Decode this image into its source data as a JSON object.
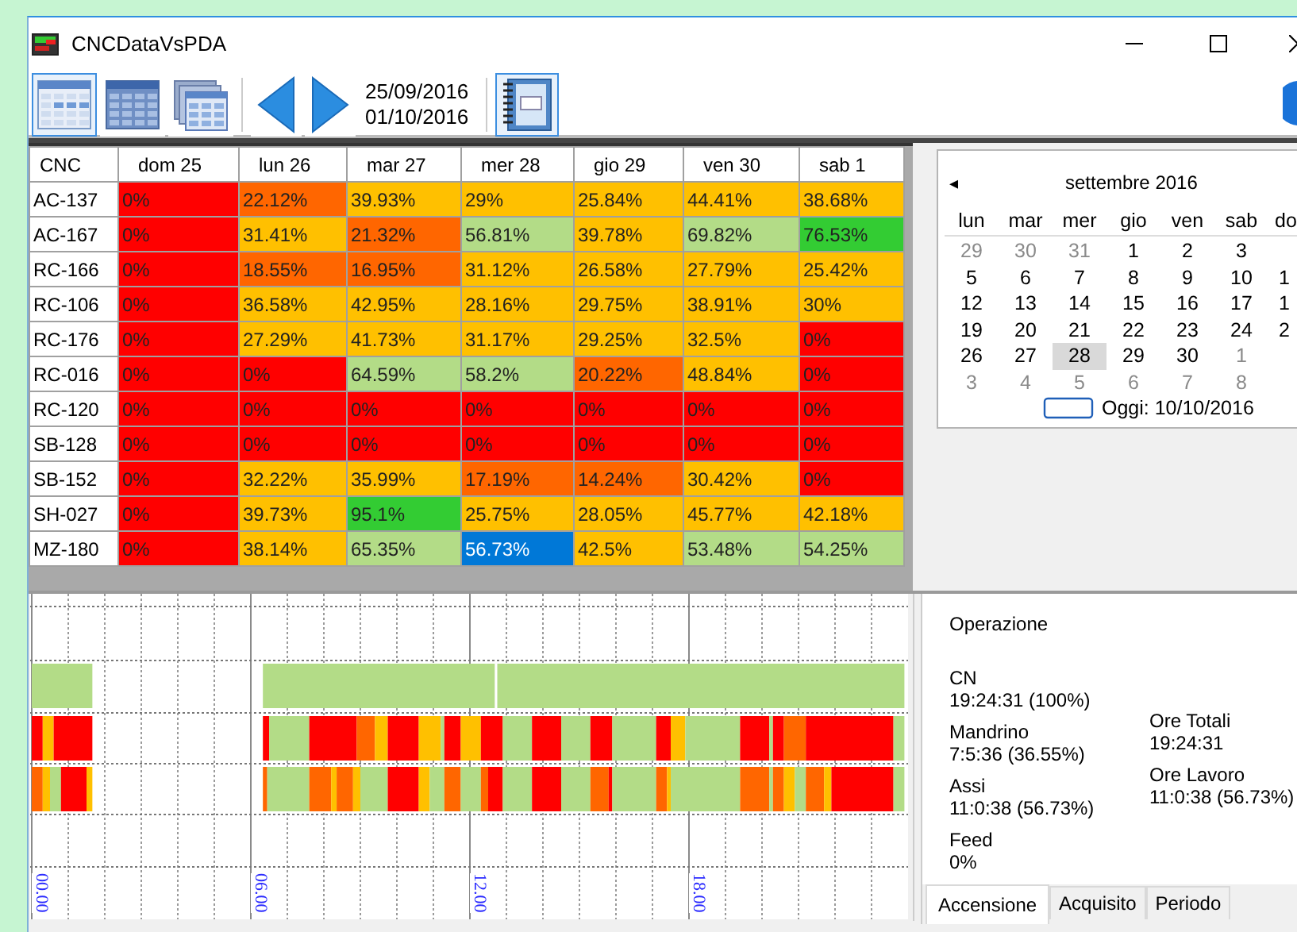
{
  "window": {
    "title": "CNCDataVsPDA"
  },
  "toolbar": {
    "view_buttons": [
      {
        "kind": "light",
        "selected": true
      },
      {
        "kind": "dark",
        "selected": false
      },
      {
        "kind": "stacked",
        "selected": false
      }
    ],
    "date_from": "25/09/2016",
    "date_to": "01/10/2016",
    "report_button": {
      "selected": true
    }
  },
  "table": {
    "columns": [
      "CNC",
      "dom 25",
      "lun 26",
      "mar 27",
      "mer 28",
      "gio 29",
      "ven 30",
      "sab 1"
    ],
    "rows": [
      {
        "cells": [
          {
            "kind": "name",
            "text": "AC-137"
          },
          {
            "kind": "value",
            "text": "0%",
            "color": "#ff0000",
            "selected": false
          },
          {
            "kind": "value",
            "text": "22.12%",
            "color": "#ff6600",
            "selected": false
          },
          {
            "kind": "value",
            "text": "39.93%",
            "color": "#ffc000",
            "selected": false
          },
          {
            "kind": "value",
            "text": "29%",
            "color": "#ffc000",
            "selected": false
          },
          {
            "kind": "value",
            "text": "25.84%",
            "color": "#ffc000",
            "selected": false
          },
          {
            "kind": "value",
            "text": "44.41%",
            "color": "#ffc000",
            "selected": false
          },
          {
            "kind": "value",
            "text": "38.68%",
            "color": "#ffc000",
            "selected": false
          }
        ]
      },
      {
        "cells": [
          {
            "kind": "name",
            "text": "AC-167"
          },
          {
            "kind": "value",
            "text": "0%",
            "color": "#ff0000",
            "selected": false
          },
          {
            "kind": "value",
            "text": "31.41%",
            "color": "#ffc000",
            "selected": false
          },
          {
            "kind": "value",
            "text": "21.32%",
            "color": "#ff6600",
            "selected": false
          },
          {
            "kind": "value",
            "text": "56.81%",
            "color": "#b3dc87",
            "selected": false
          },
          {
            "kind": "value",
            "text": "39.78%",
            "color": "#ffc000",
            "selected": false
          },
          {
            "kind": "value",
            "text": "69.82%",
            "color": "#b3dc87",
            "selected": false
          },
          {
            "kind": "value",
            "text": "76.53%",
            "color": "#33cc33",
            "selected": false
          }
        ]
      },
      {
        "cells": [
          {
            "kind": "name",
            "text": "RC-166"
          },
          {
            "kind": "value",
            "text": "0%",
            "color": "#ff0000",
            "selected": false
          },
          {
            "kind": "value",
            "text": "18.55%",
            "color": "#ff6600",
            "selected": false
          },
          {
            "kind": "value",
            "text": "16.95%",
            "color": "#ff6600",
            "selected": false
          },
          {
            "kind": "value",
            "text": "31.12%",
            "color": "#ffc000",
            "selected": false
          },
          {
            "kind": "value",
            "text": "26.58%",
            "color": "#ffc000",
            "selected": false
          },
          {
            "kind": "value",
            "text": "27.79%",
            "color": "#ffc000",
            "selected": false
          },
          {
            "kind": "value",
            "text": "25.42%",
            "color": "#ffc000",
            "selected": false
          }
        ]
      },
      {
        "cells": [
          {
            "kind": "name",
            "text": "RC-106"
          },
          {
            "kind": "value",
            "text": "0%",
            "color": "#ff0000",
            "selected": false
          },
          {
            "kind": "value",
            "text": "36.58%",
            "color": "#ffc000",
            "selected": false
          },
          {
            "kind": "value",
            "text": "42.95%",
            "color": "#ffc000",
            "selected": false
          },
          {
            "kind": "value",
            "text": "28.16%",
            "color": "#ffc000",
            "selected": false
          },
          {
            "kind": "value",
            "text": "29.75%",
            "color": "#ffc000",
            "selected": false
          },
          {
            "kind": "value",
            "text": "38.91%",
            "color": "#ffc000",
            "selected": false
          },
          {
            "kind": "value",
            "text": "30%",
            "color": "#ffc000",
            "selected": false
          }
        ]
      },
      {
        "cells": [
          {
            "kind": "name",
            "text": "RC-176"
          },
          {
            "kind": "value",
            "text": "0%",
            "color": "#ff0000",
            "selected": false
          },
          {
            "kind": "value",
            "text": "27.29%",
            "color": "#ffc000",
            "selected": false
          },
          {
            "kind": "value",
            "text": "41.73%",
            "color": "#ffc000",
            "selected": false
          },
          {
            "kind": "value",
            "text": "31.17%",
            "color": "#ffc000",
            "selected": false
          },
          {
            "kind": "value",
            "text": "29.25%",
            "color": "#ffc000",
            "selected": false
          },
          {
            "kind": "value",
            "text": "32.5%",
            "color": "#ffc000",
            "selected": false
          },
          {
            "kind": "value",
            "text": "0%",
            "color": "#ff0000",
            "selected": false
          }
        ]
      },
      {
        "cells": [
          {
            "kind": "name",
            "text": "RC-016"
          },
          {
            "kind": "value",
            "text": "0%",
            "color": "#ff0000",
            "selected": false
          },
          {
            "kind": "value",
            "text": "0%",
            "color": "#ff0000",
            "selected": false
          },
          {
            "kind": "value",
            "text": "64.59%",
            "color": "#b3dc87",
            "selected": false
          },
          {
            "kind": "value",
            "text": "58.2%",
            "color": "#b3dc87",
            "selected": false
          },
          {
            "kind": "value",
            "text": "20.22%",
            "color": "#ff6600",
            "selected": false
          },
          {
            "kind": "value",
            "text": "48.84%",
            "color": "#ffc000",
            "selected": false
          },
          {
            "kind": "value",
            "text": "0%",
            "color": "#ff0000",
            "selected": false
          }
        ]
      },
      {
        "cells": [
          {
            "kind": "name",
            "text": "RC-120"
          },
          {
            "kind": "value",
            "text": "0%",
            "color": "#ff0000",
            "selected": false
          },
          {
            "kind": "value",
            "text": "0%",
            "color": "#ff0000",
            "selected": false
          },
          {
            "kind": "value",
            "text": "0%",
            "color": "#ff0000",
            "selected": false
          },
          {
            "kind": "value",
            "text": "0%",
            "color": "#ff0000",
            "selected": false
          },
          {
            "kind": "value",
            "text": "0%",
            "color": "#ff0000",
            "selected": false
          },
          {
            "kind": "value",
            "text": "0%",
            "color": "#ff0000",
            "selected": false
          },
          {
            "kind": "value",
            "text": "0%",
            "color": "#ff0000",
            "selected": false
          }
        ]
      },
      {
        "cells": [
          {
            "kind": "name",
            "text": "SB-128"
          },
          {
            "kind": "value",
            "text": "0%",
            "color": "#ff0000",
            "selected": false
          },
          {
            "kind": "value",
            "text": "0%",
            "color": "#ff0000",
            "selected": false
          },
          {
            "kind": "value",
            "text": "0%",
            "color": "#ff0000",
            "selected": false
          },
          {
            "kind": "value",
            "text": "0%",
            "color": "#ff0000",
            "selected": false
          },
          {
            "kind": "value",
            "text": "0%",
            "color": "#ff0000",
            "selected": false
          },
          {
            "kind": "value",
            "text": "0%",
            "color": "#ff0000",
            "selected": false
          },
          {
            "kind": "value",
            "text": "0%",
            "color": "#ff0000",
            "selected": false
          }
        ]
      },
      {
        "cells": [
          {
            "kind": "name",
            "text": "SB-152"
          },
          {
            "kind": "value",
            "text": "0%",
            "color": "#ff0000",
            "selected": false
          },
          {
            "kind": "value",
            "text": "32.22%",
            "color": "#ffc000",
            "selected": false
          },
          {
            "kind": "value",
            "text": "35.99%",
            "color": "#ffc000",
            "selected": false
          },
          {
            "kind": "value",
            "text": "17.19%",
            "color": "#ff6600",
            "selected": false
          },
          {
            "kind": "value",
            "text": "14.24%",
            "color": "#ff6600",
            "selected": false
          },
          {
            "kind": "value",
            "text": "30.42%",
            "color": "#ffc000",
            "selected": false
          },
          {
            "kind": "value",
            "text": "0%",
            "color": "#ff0000",
            "selected": false
          }
        ]
      },
      {
        "cells": [
          {
            "kind": "name",
            "text": "SH-027"
          },
          {
            "kind": "value",
            "text": "0%",
            "color": "#ff0000",
            "selected": false
          },
          {
            "kind": "value",
            "text": "39.73%",
            "color": "#ffc000",
            "selected": false
          },
          {
            "kind": "value",
            "text": "95.1%",
            "color": "#33cc33",
            "selected": false
          },
          {
            "kind": "value",
            "text": "25.75%",
            "color": "#ffc000",
            "selected": false
          },
          {
            "kind": "value",
            "text": "28.05%",
            "color": "#ffc000",
            "selected": false
          },
          {
            "kind": "value",
            "text": "45.77%",
            "color": "#ffc000",
            "selected": false
          },
          {
            "kind": "value",
            "text": "42.18%",
            "color": "#ffc000",
            "selected": false
          }
        ]
      },
      {
        "cells": [
          {
            "kind": "name",
            "text": "MZ-180"
          },
          {
            "kind": "value",
            "text": "0%",
            "color": "#ff0000",
            "selected": false
          },
          {
            "kind": "value",
            "text": "38.14%",
            "color": "#ffc000",
            "selected": false
          },
          {
            "kind": "value",
            "text": "65.35%",
            "color": "#b3dc87",
            "selected": false
          },
          {
            "kind": "value",
            "text": "56.73%",
            "selected": true
          },
          {
            "kind": "value",
            "text": "42.5%",
            "color": "#ffc000",
            "selected": false
          },
          {
            "kind": "value",
            "text": "53.48%",
            "color": "#b3dc87",
            "selected": false
          },
          {
            "kind": "value",
            "text": "54.25%",
            "color": "#b3dc87",
            "selected": false
          }
        ]
      }
    ]
  },
  "calendar": {
    "prev": "◂",
    "month": "settembre 2016",
    "weekdays": [
      "lun",
      "mar",
      "mer",
      "gio",
      "ven",
      "sab",
      "do"
    ],
    "weeks": [
      [
        {
          "day": "29",
          "other_month": true,
          "selected": false
        },
        {
          "day": "30",
          "other_month": true,
          "selected": false
        },
        {
          "day": "31",
          "other_month": true,
          "selected": false
        },
        {
          "day": "1",
          "other_month": false,
          "selected": false
        },
        {
          "day": "2",
          "other_month": false,
          "selected": false
        },
        {
          "day": "3",
          "other_month": false,
          "selected": false
        }
      ],
      [
        {
          "day": "5",
          "other_month": false,
          "selected": false
        },
        {
          "day": "6",
          "other_month": false,
          "selected": false
        },
        {
          "day": "7",
          "other_month": false,
          "selected": false
        },
        {
          "day": "8",
          "other_month": false,
          "selected": false
        },
        {
          "day": "9",
          "other_month": false,
          "selected": false
        },
        {
          "day": "10",
          "other_month": false,
          "selected": false
        },
        {
          "day": "1",
          "other_month": false,
          "selected": false
        }
      ],
      [
        {
          "day": "12",
          "other_month": false,
          "selected": false
        },
        {
          "day": "13",
          "other_month": false,
          "selected": false
        },
        {
          "day": "14",
          "other_month": false,
          "selected": false
        },
        {
          "day": "15",
          "other_month": false,
          "selected": false
        },
        {
          "day": "16",
          "other_month": false,
          "selected": false
        },
        {
          "day": "17",
          "other_month": false,
          "selected": false
        },
        {
          "day": "1",
          "other_month": false,
          "selected": false
        }
      ],
      [
        {
          "day": "19",
          "other_month": false,
          "selected": false
        },
        {
          "day": "20",
          "other_month": false,
          "selected": false
        },
        {
          "day": "21",
          "other_month": false,
          "selected": false
        },
        {
          "day": "22",
          "other_month": false,
          "selected": false
        },
        {
          "day": "23",
          "other_month": false,
          "selected": false
        },
        {
          "day": "24",
          "other_month": false,
          "selected": false
        },
        {
          "day": "2",
          "other_month": false,
          "selected": false
        }
      ],
      [
        {
          "day": "26",
          "other_month": false,
          "selected": false
        },
        {
          "day": "27",
          "other_month": false,
          "selected": false
        },
        {
          "day": "28",
          "other_month": false,
          "selected": true
        },
        {
          "day": "29",
          "other_month": false,
          "selected": false
        },
        {
          "day": "30",
          "other_month": false,
          "selected": false
        },
        {
          "day": "1",
          "other_month": true,
          "selected": false
        }
      ],
      [
        {
          "day": "3",
          "other_month": true,
          "selected": false
        },
        {
          "day": "4",
          "other_month": true,
          "selected": false
        },
        {
          "day": "5",
          "other_month": true,
          "selected": false
        },
        {
          "day": "6",
          "other_month": true,
          "selected": false
        },
        {
          "day": "7",
          "other_month": true,
          "selected": false
        },
        {
          "day": "8",
          "other_month": true,
          "selected": false
        }
      ]
    ],
    "today": "Oggi: 10/10/2016"
  },
  "timeline": {
    "time_labels": [
      "00.00",
      "06.00",
      "12.00",
      "18.00"
    ]
  },
  "info": {
    "title": "Operazione",
    "left": [
      {
        "label": "CN",
        "value": "19:24:31 (100%)"
      },
      {
        "label": "Mandrino",
        "value": "7:5:36 (36.55%)"
      },
      {
        "label": "Assi",
        "value": "11:0:38 (56.73%)"
      },
      {
        "label": "Feed",
        "value": "0%"
      }
    ],
    "right": [
      {
        "label": "Ore Totali",
        "value": "19:24:31"
      },
      {
        "label": "Ore Lavoro",
        "value": "11:0:38 (56.73%)"
      }
    ],
    "tabs": [
      {
        "label": "Accensione",
        "selected": true
      },
      {
        "label": "Acquisito",
        "selected": false
      },
      {
        "label": "Periodo",
        "selected": false
      }
    ]
  }
}
